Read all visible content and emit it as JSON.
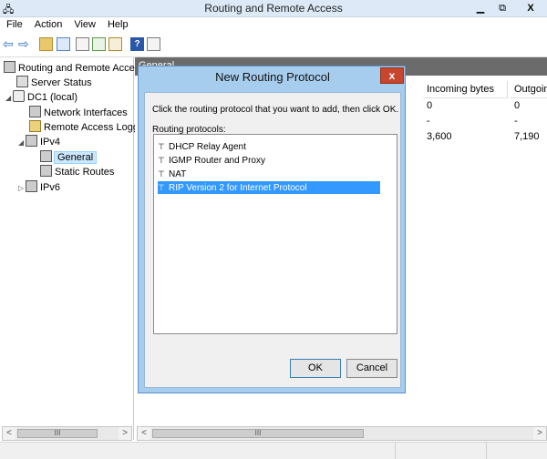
{
  "window": {
    "title": "Routing and Remote Access",
    "min": "▁",
    "restore": "⧉",
    "close": "X"
  },
  "menu": [
    "File",
    "Action",
    "View",
    "Help"
  ],
  "tree": {
    "root": "Routing and Remote Access",
    "server_status": "Server Status",
    "server": "DC1 (local)",
    "network_interfaces": "Network Interfaces",
    "remote_access_logging": "Remote Access Logging",
    "ipv4": "IPv4",
    "general": "General",
    "static_routes": "Static Routes",
    "ipv6": "IPv6"
  },
  "content": {
    "header_fragment": "General",
    "columns": [
      "Incoming bytes",
      "Outgoing"
    ],
    "rows": [
      [
        "0",
        "0"
      ],
      [
        "-",
        "-"
      ],
      [
        "3,600",
        "7,190"
      ]
    ]
  },
  "scroll": {
    "left_arrow": "<",
    "right_arrow": ">",
    "thumb": "III"
  },
  "dialog": {
    "title": "New Routing Protocol",
    "close": "x",
    "instruction": "Click the routing protocol that you want to add, then click OK.",
    "list_label": "Routing protocols:",
    "protocols": [
      "DHCP Relay Agent",
      "IGMP Router and Proxy",
      "NAT",
      "RIP Version 2 for Internet Protocol"
    ],
    "ok": "OK",
    "cancel": "Cancel"
  },
  "colors": {
    "selection": "#3399ff",
    "titlebar": "#dde9f7",
    "dialog_frame": "#a7cdee",
    "close_button": "#c7462d"
  }
}
